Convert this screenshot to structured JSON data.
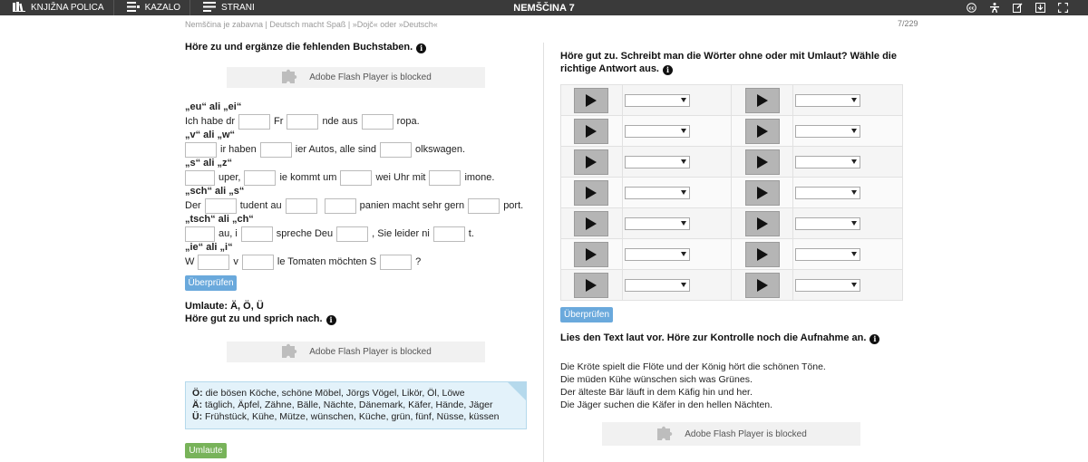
{
  "topbar": {
    "library": "KNJIŽNA POLICA",
    "contents": "KAZALO",
    "pages": "STRANI",
    "title": "NEMŠČINA 7"
  },
  "breadcrumb": "Nemščina je zabavna | Deutsch macht Spaß | »Dojč« oder »Deutsch«",
  "page_counter": "7/229",
  "left": {
    "task1_heading": "Höre zu und ergänze die fehlenden Buchstaben.",
    "flash_text": "Adobe Flash Player is blocked",
    "groups": [
      {
        "label": "„eu“ ali „ei“",
        "parts": [
          "Ich habe dr",
          "Fr",
          "nde aus",
          "ropa."
        ]
      },
      {
        "label": "„v“ ali „w“",
        "parts": [
          "",
          "ir haben",
          "ier Autos, alle sind",
          "olkswagen."
        ]
      },
      {
        "label": "„s“ ali „z“",
        "parts": [
          "",
          "uper,",
          "ie kommt um",
          "wei Uhr mit",
          "imone."
        ]
      },
      {
        "label": "„sch“ ali „s“",
        "parts": [
          "Der",
          "tudent au",
          "",
          "panien macht sehr gern",
          "port."
        ]
      },
      {
        "label": "„tsch“ ali „ch“",
        "parts": [
          "",
          "au, i",
          "spreche Deu",
          ", Sie leider ni",
          "t."
        ]
      },
      {
        "label": "„ie“ ali „i“",
        "parts": [
          "W",
          "v",
          "le Tomaten möchten S",
          "?"
        ]
      }
    ],
    "check_label": "Überprüfen",
    "umlaute_title": "Umlaute: Ä, Ö, Ü",
    "task2_heading": "Höre gut zu und sprich nach.",
    "info_lines": [
      {
        "letter": "Ö:",
        "text": "die bösen Köche, schöne Möbel, Jörgs Vögel, Likör, Öl, Löwe"
      },
      {
        "letter": "Ä:",
        "text": "täglich, Äpfel, Zähne, Bälle, Nächte, Dänemark, Käfer, Hände, Jäger"
      },
      {
        "letter": "Ü:",
        "text": "Frühstück, Kühe, Mütze, wünschen, Küche, grün, fünf, Nüsse, küssen"
      }
    ],
    "umlaute_button": "Umlaute"
  },
  "right": {
    "task3_heading_line1": "Höre gut zu. Schreibt man die Wörter ohne oder mit Umlaut? Wähle die",
    "task3_heading_line2": "richtige Antwort aus.",
    "rows": 7,
    "check_label": "Überprüfen",
    "task4_heading": "Lies den Text laut vor. Höre zur Kontrolle noch die Aufnahme an.",
    "poem": [
      "Die Kröte spielt die Flöte und der König hört die schönen Töne.",
      "Die müden Kühe wünschen sich was Grünes.",
      "Der älteste Bär läuft in dem Käfig hin und her.",
      "Die Jäger suchen die Käfer in den hellen Nächten."
    ],
    "flash_text": "Adobe Flash Player is blocked"
  }
}
